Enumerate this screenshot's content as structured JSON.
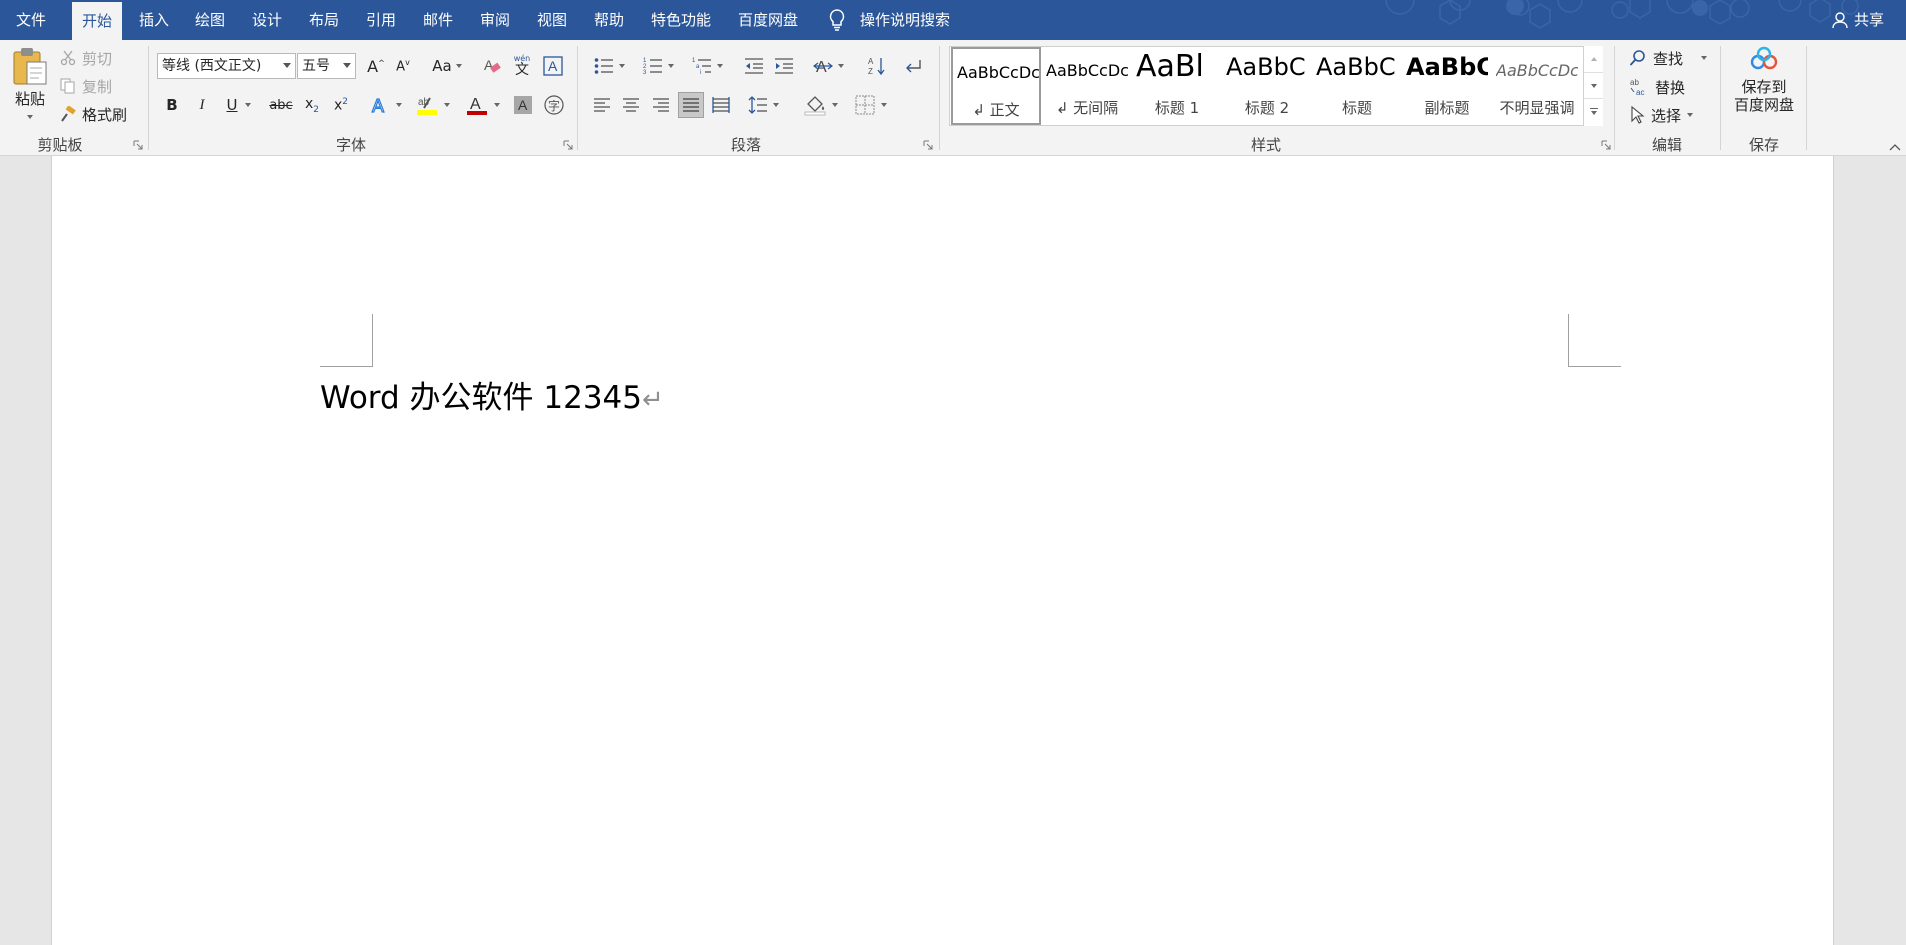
{
  "tabs": [
    "文件",
    "开始",
    "插入",
    "绘图",
    "设计",
    "布局",
    "引用",
    "邮件",
    "审阅",
    "视图",
    "帮助",
    "特色功能",
    "百度网盘"
  ],
  "active_tab": "开始",
  "tell_me": "操作说明搜索",
  "share": "共享",
  "clipboard": {
    "paste": "粘贴",
    "cut": "剪切",
    "copy": "复制",
    "format_painter": "格式刷",
    "group": "剪贴板"
  },
  "font": {
    "name": "等线 (西文正文)",
    "size": "五号",
    "group": "字体",
    "change_case": "Aa",
    "strikethrough": "abc",
    "phonetic_top": "wén",
    "phonetic_bottom": "文",
    "enclose": "字"
  },
  "paragraph": {
    "group": "段落"
  },
  "styles": {
    "group": "样式",
    "items": [
      {
        "preview": "AaBbCcDc",
        "name": "↲ 正文"
      },
      {
        "preview": "AaBbCcDc",
        "name": "↲ 无间隔"
      },
      {
        "preview": "AaBl",
        "name": "标题 1"
      },
      {
        "preview": "AaBbC",
        "name": "标题 2"
      },
      {
        "preview": "AaBbC",
        "name": "标题"
      },
      {
        "preview": "AaBbC",
        "name": "副标题"
      },
      {
        "preview": "AaBbCcDc",
        "name": "不明显强调"
      }
    ]
  },
  "editing": {
    "find": "查找",
    "replace": "替换",
    "select": "选择",
    "group": "编辑",
    "replace_icon_top": "ab",
    "replace_icon_bottom": "ac"
  },
  "save": {
    "label_line1": "保存到",
    "label_line2": "百度网盘",
    "group": "保存"
  },
  "document": {
    "text": "Word 办公软件 12345",
    "para_mark": "↵"
  },
  "colors": {
    "accent": "#2b579a",
    "highlight": "#ffff00",
    "font_color": "#c00000"
  }
}
